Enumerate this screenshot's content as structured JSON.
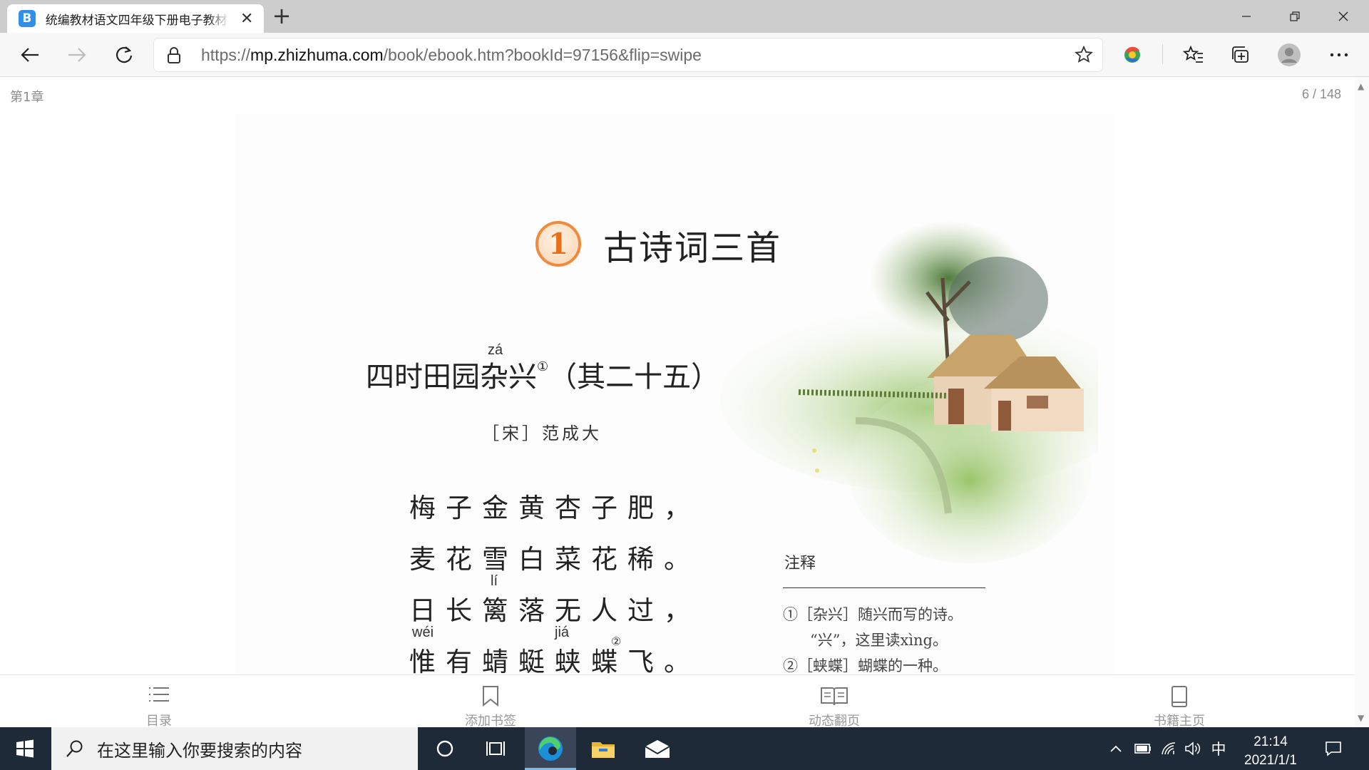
{
  "browser": {
    "tab_title": "统编教材语文四年级下册电子教材",
    "favicon_letter": "B",
    "url_scheme": "https://",
    "url_host": "mp.zhizhuma.com",
    "url_path": "/book/ebook.htm?bookId=97156&flip=swipe"
  },
  "reader": {
    "chapter": "第1章",
    "page_indicator": "6 / 148"
  },
  "lesson": {
    "number": "1",
    "title": "古诗词三首",
    "poem_title": "四时田园杂兴",
    "poem_title_note": "①",
    "poem_title_suffix": "（其二十五）",
    "pinyin_za": "zá",
    "author": "［宋］范成大",
    "verses": [
      "梅子金黄杏子肥，",
      "麦花雪白菜花稀。",
      "日长篱落无人过，",
      "惟有蜻蜓蛱蝶飞。"
    ],
    "verse4_note": "②",
    "pinyin_li": "lí",
    "pinyin_wei": "wéi",
    "pinyin_jia": "jiá"
  },
  "notes": {
    "title": "注释",
    "items": [
      "①［杂兴］随兴而写的诗。",
      "“兴”，这里读xìng。",
      "②［蛱蝶］蝴蝶的一种。"
    ]
  },
  "reader_toolbar": {
    "toc": "目录",
    "bookmark": "添加书签",
    "flip": "动态翻页",
    "home": "书籍主页"
  },
  "taskbar": {
    "search_placeholder": "在这里输入你要搜索的内容",
    "time": "21:14",
    "date": "2021/1/1",
    "ime": "中"
  },
  "colors": {
    "accent_orange": "#f08a3c",
    "taskbar_bg": "#1f2a38",
    "tab_strip_bg": "#cdcdcd"
  },
  "icons": [
    "back-icon",
    "forward-icon",
    "refresh-icon",
    "lock-icon",
    "star-icon",
    "extension-icon",
    "favorites-icon",
    "collections-icon",
    "profile-icon",
    "more-icon",
    "toc-icon",
    "bookmark-icon",
    "open-book-icon",
    "book-icon",
    "windows-icon",
    "search-icon",
    "cortana-icon",
    "task-view-icon",
    "edge-icon",
    "file-explorer-icon",
    "mail-icon",
    "chevron-up-icon",
    "battery-icon",
    "network-icon",
    "volume-icon",
    "notification-icon"
  ]
}
